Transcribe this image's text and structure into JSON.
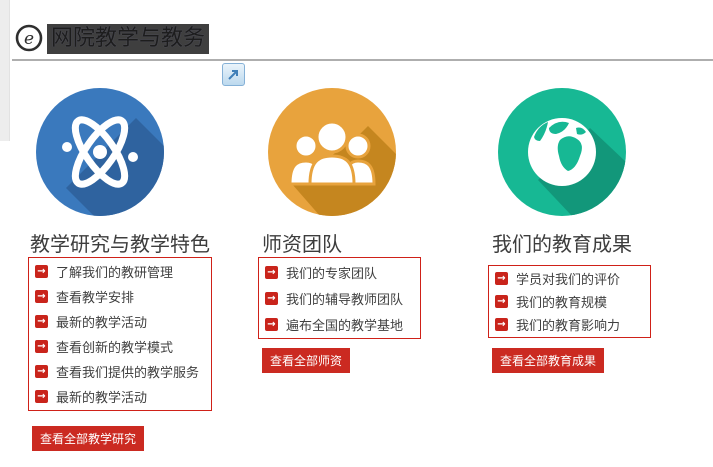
{
  "header": {
    "logo_icon": "circled-e-icon",
    "title": "网院教学与教务",
    "expand_icon": "open-in-new-icon"
  },
  "colors": {
    "accent_red": "#cb2a21",
    "link_border_red": "#cf2118",
    "blue_circle": "#3a79bd",
    "blue_shadow": "#2f639f",
    "orange_circle": "#e8a33d",
    "orange_shadow": "#c5861f",
    "green_circle": "#17b894",
    "green_shadow": "#12977a",
    "title_bar_bg": "#3f3f3f",
    "divider_gray": "#aeaeae"
  },
  "columns": [
    {
      "icon": "atom-icon",
      "heading": "教学研究与教学特色",
      "links": [
        "了解我们的教研管理",
        "查看教学安排",
        "最新的教学活动",
        "查看创新的教学模式",
        "查看我们提供的教学服务",
        "最新的教学活动"
      ],
      "button": "查看全部教学研究"
    },
    {
      "icon": "team-icon",
      "heading": "师资团队",
      "links": [
        "我们的专家团队",
        "我们的辅导教师团队",
        "遍布全国的教学基地"
      ],
      "button": "查看全部师资"
    },
    {
      "icon": "globe-icon",
      "heading": "我们的教育成果",
      "links": [
        "学员对我们的评价",
        "我们的教育规模",
        "我们的教育影响力"
      ],
      "button": "查看全部教育成果"
    }
  ]
}
